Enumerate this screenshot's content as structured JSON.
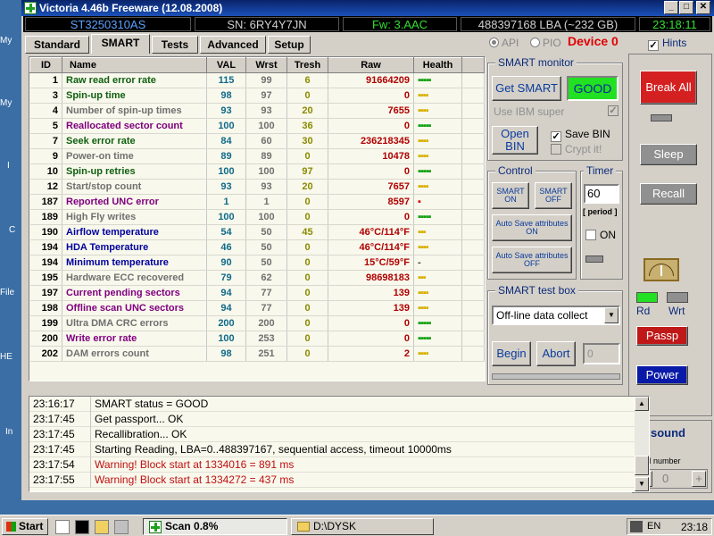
{
  "window": {
    "title": "Victoria 4.46b Freeware (12.08.2008)",
    "controls": {
      "minimize": "_",
      "maximize": "□",
      "close": "✕"
    }
  },
  "desktop_labels": [
    "My",
    "My",
    "I",
    "C",
    "File",
    "HE",
    "In"
  ],
  "info": {
    "model": "ST3250310AS",
    "serial": "SN: 6RY4Y7JN",
    "firmware": "Fw: 3.AAC",
    "lba": "488397168 LBA (~232 GB)",
    "clock": "23:18:11"
  },
  "tabs": [
    "Standard",
    "SMART",
    "Tests",
    "Advanced",
    "Setup"
  ],
  "active_tab": "SMART",
  "mode": {
    "api_label": "API",
    "pio_label": "PIO",
    "device_label": "Device 0",
    "hints_label": "Hints"
  },
  "smart_table": {
    "headers": [
      "ID",
      "Name",
      "VAL",
      "Wrst",
      "Tresh",
      "Raw",
      "Health"
    ],
    "rows": [
      {
        "id": "1",
        "name": "Raw read error rate",
        "val": "115",
        "wrst": "99",
        "tresh": "6",
        "raw": "91664209",
        "health": "▪▪▪▪▪",
        "nc": "#106010",
        "hc": "#10a010"
      },
      {
        "id": "3",
        "name": "Spin-up time",
        "val": "98",
        "wrst": "97",
        "tresh": "0",
        "raw": "0",
        "health": "▪▪▪▪",
        "nc": "#106010",
        "hc": "#d8b000"
      },
      {
        "id": "4",
        "name": "Number of spin-up times",
        "val": "93",
        "wrst": "93",
        "tresh": "20",
        "raw": "7655",
        "health": "▪▪▪▪",
        "nc": "#707070",
        "hc": "#d8b000"
      },
      {
        "id": "5",
        "name": "Reallocated sector count",
        "val": "100",
        "wrst": "100",
        "tresh": "36",
        "raw": "0",
        "health": "▪▪▪▪▪",
        "nc": "#800080",
        "hc": "#10a010"
      },
      {
        "id": "7",
        "name": "Seek error rate",
        "val": "84",
        "wrst": "60",
        "tresh": "30",
        "raw": "236218345",
        "health": "▪▪▪▪",
        "nc": "#106010",
        "hc": "#d8b000"
      },
      {
        "id": "9",
        "name": "Power-on time",
        "val": "89",
        "wrst": "89",
        "tresh": "0",
        "raw": "10478",
        "health": "▪▪▪▪",
        "nc": "#707070",
        "hc": "#d8b000"
      },
      {
        "id": "10",
        "name": "Spin-up retries",
        "val": "100",
        "wrst": "100",
        "tresh": "97",
        "raw": "0",
        "health": "▪▪▪▪▪",
        "nc": "#106010",
        "hc": "#10a010"
      },
      {
        "id": "12",
        "name": "Start/stop count",
        "val": "93",
        "wrst": "93",
        "tresh": "20",
        "raw": "7657",
        "health": "▪▪▪▪",
        "nc": "#707070",
        "hc": "#d8b000"
      },
      {
        "id": "187",
        "name": "Reported UNC error",
        "val": "1",
        "wrst": "1",
        "tresh": "0",
        "raw": "8597",
        "health": "▪",
        "nc": "#800080",
        "hc": "#e01010"
      },
      {
        "id": "189",
        "name": "High Fly writes",
        "val": "100",
        "wrst": "100",
        "tresh": "0",
        "raw": "0",
        "health": "▪▪▪▪▪",
        "nc": "#707070",
        "hc": "#10a010"
      },
      {
        "id": "190",
        "name": "Airflow temperature",
        "val": "54",
        "wrst": "50",
        "tresh": "45",
        "raw": "46°C/114°F",
        "health": "▪▪▪",
        "nc": "#0000a0",
        "hc": "#d8b000"
      },
      {
        "id": "194",
        "name": "HDA Temperature",
        "val": "46",
        "wrst": "50",
        "tresh": "0",
        "raw": "46°C/114°F",
        "health": "▪▪▪▪",
        "nc": "#0000a0",
        "hc": "#d8b000"
      },
      {
        "id": "194",
        "name": "Minimum temperature",
        "val": "90",
        "wrst": "50",
        "tresh": "0",
        "raw": "15°C/59°F",
        "health": "-",
        "nc": "#0000a0",
        "hc": "#404040"
      },
      {
        "id": "195",
        "name": "Hardware ECC recovered",
        "val": "79",
        "wrst": "62",
        "tresh": "0",
        "raw": "98698183",
        "health": "▪▪▪",
        "nc": "#707070",
        "hc": "#d8b000"
      },
      {
        "id": "197",
        "name": "Current pending sectors",
        "val": "94",
        "wrst": "77",
        "tresh": "0",
        "raw": "139",
        "health": "▪▪▪▪",
        "nc": "#800080",
        "hc": "#d8b000"
      },
      {
        "id": "198",
        "name": "Offline scan UNC sectors",
        "val": "94",
        "wrst": "77",
        "tresh": "0",
        "raw": "139",
        "health": "▪▪▪▪",
        "nc": "#800080",
        "hc": "#d8b000"
      },
      {
        "id": "199",
        "name": "Ultra DMA CRC errors",
        "val": "200",
        "wrst": "200",
        "tresh": "0",
        "raw": "0",
        "health": "▪▪▪▪▪",
        "nc": "#707070",
        "hc": "#10a010"
      },
      {
        "id": "200",
        "name": "Write error rate",
        "val": "100",
        "wrst": "253",
        "tresh": "0",
        "raw": "0",
        "health": "▪▪▪▪▪",
        "nc": "#800080",
        "hc": "#10a010"
      },
      {
        "id": "202",
        "name": "DAM errors count",
        "val": "98",
        "wrst": "251",
        "tresh": "0",
        "raw": "2",
        "health": "▪▪▪▪",
        "nc": "#707070",
        "hc": "#d8b000"
      }
    ]
  },
  "smart_monitor": {
    "title": "SMART monitor",
    "get_smart": "Get SMART",
    "status": "GOOD",
    "ibm_super": "Use IBM super",
    "ibm_check": "✓",
    "open_bin": "Open BIN",
    "save_bin": "Save BIN",
    "save_check": "✓",
    "crypt": "Crypt it!"
  },
  "control": {
    "title": "Control",
    "smart_on": "SMART ON",
    "smart_off": "SMART OFF",
    "autosave_on": "Auto Save attributes ON",
    "autosave_off": "Auto Save attributes OFF"
  },
  "timer": {
    "title": "Timer",
    "value": "60",
    "period": "[ period ]",
    "on_label": "ON"
  },
  "test_box": {
    "title": "SMART test box",
    "selected": "Off-line data collect",
    "begin": "Begin",
    "abort": "Abort",
    "count": "0"
  },
  "right_panel": {
    "break_all": "Break All",
    "sleep": "Sleep",
    "recall": "Recall",
    "rd": "Rd",
    "wrt": "Wrt",
    "passp": "Passp",
    "power": "Power",
    "sound": "sound",
    "sound_check": "✓",
    "api_number_label": "API number",
    "api_number": "0"
  },
  "log": [
    {
      "time": "23:16:17",
      "msg": "SMART status = GOOD",
      "color": "#000000"
    },
    {
      "time": "23:17:45",
      "msg": "Get passport... OK",
      "color": "#000000"
    },
    {
      "time": "23:17:45",
      "msg": "Recallibration... OK",
      "color": "#000000"
    },
    {
      "time": "23:17:45",
      "msg": "Starting Reading, LBA=0..488397167, sequential access, timeout 10000ms",
      "color": "#000000"
    },
    {
      "time": "23:17:54",
      "msg": "Warning! Block start at 1334016 = 891 ms",
      "color": "#c01010"
    },
    {
      "time": "23:17:55",
      "msg": "Warning! Block start at 1334272 = 437 ms",
      "color": "#c01010"
    }
  ],
  "taskbar": {
    "start": "Start",
    "scan_task": "Scan 0.8%",
    "folder_task": "D:\\DYSK",
    "lang": "EN",
    "clock": "23:18"
  }
}
